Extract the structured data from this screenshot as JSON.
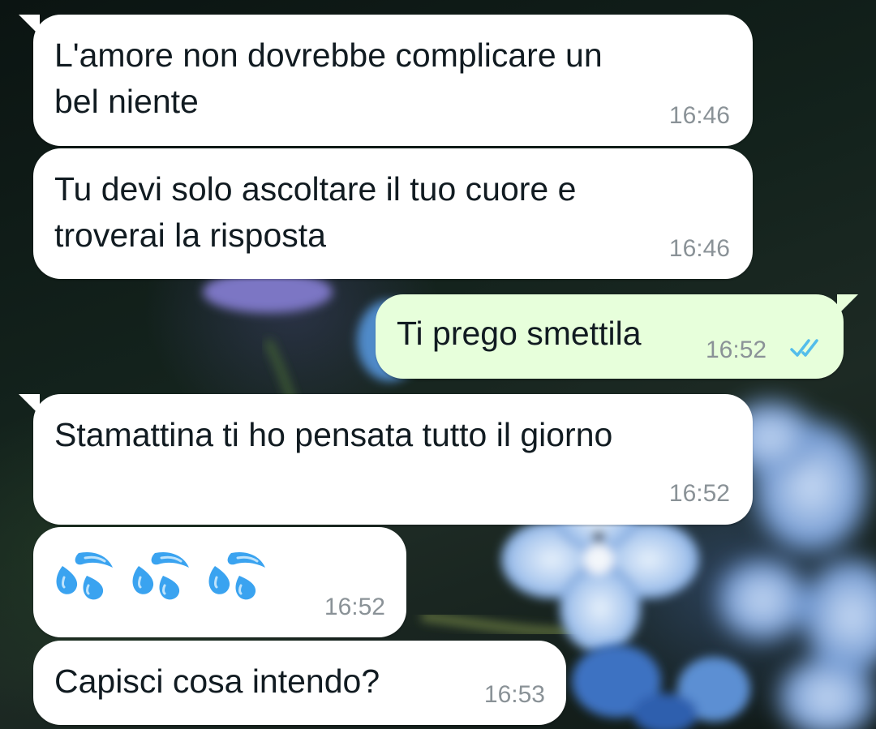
{
  "wallpaper": {
    "description_icon": "flower-wallpaper"
  },
  "colors": {
    "incoming_bubble": "#ffffff",
    "outgoing_bubble": "#e7ffdb",
    "text": "#111b21",
    "time": "#8a9297",
    "read_ticks": "#53bdeb",
    "emoji_blue": "#3aa3f0"
  },
  "messages": [
    {
      "direction": "incoming",
      "text": "L'amore non dovrebbe complicare un\nbel niente",
      "time": "16:46"
    },
    {
      "direction": "incoming",
      "text": "Tu devi solo ascoltare il tuo cuore e\ntroverai la risposta",
      "time": "16:46"
    },
    {
      "direction": "outgoing",
      "text": "Ti prego smettila",
      "time": "16:52",
      "status_icon": "double-check-read-icon"
    },
    {
      "direction": "incoming",
      "text": "Stamattina ti ho pensata tutto il giorno",
      "time": "16:52"
    },
    {
      "direction": "incoming",
      "emoji": [
        "sweat-droplets-icon",
        "sweat-droplets-icon",
        "sweat-droplets-icon"
      ],
      "time": "16:52"
    },
    {
      "direction": "incoming",
      "text": "Capisci cosa intendo?",
      "time": "16:53"
    }
  ]
}
